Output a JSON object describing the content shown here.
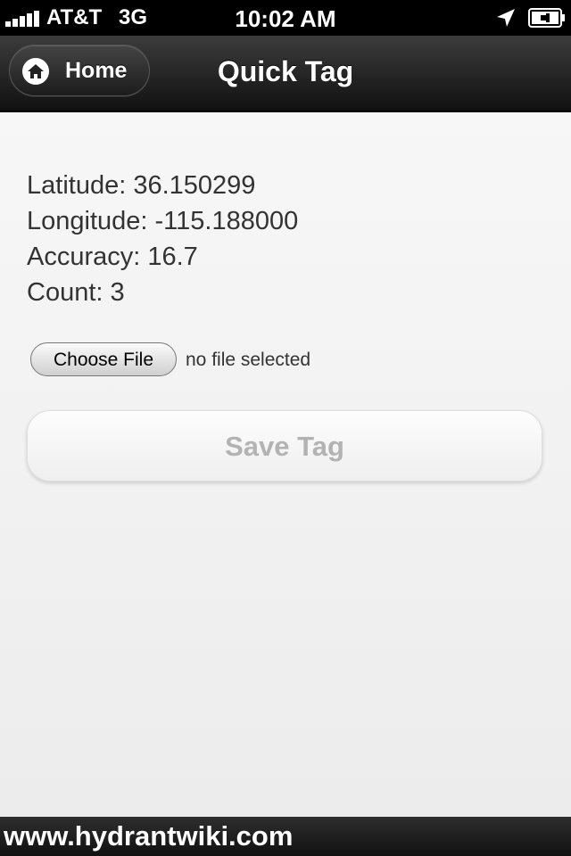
{
  "status_bar": {
    "carrier": "AT&T",
    "network": "3G",
    "time": "10:02 AM",
    "icons": [
      "signal-bars-icon",
      "location-arrow-icon",
      "battery-charging-icon"
    ]
  },
  "header": {
    "home_label": "Home",
    "title": "Quick Tag"
  },
  "location": {
    "latitude": "Latitude: 36.150299",
    "longitude": "Longitude: -115.188000",
    "accuracy": "Accuracy: 16.7",
    "count": "Count: 3"
  },
  "file_input": {
    "button_label": "Choose File",
    "status": "no file selected"
  },
  "save_button_label": "Save Tag",
  "footer": {
    "url": "www.hydrantwiki.com"
  },
  "colors": {
    "header_bg": "#1c1c1c",
    "content_bg": "#f2f2f2",
    "disabled_text": "#b3b3b3"
  }
}
